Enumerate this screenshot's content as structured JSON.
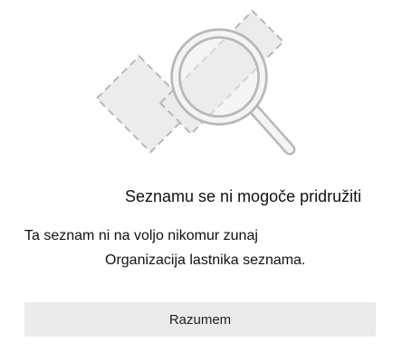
{
  "dialog": {
    "illustration_icon": "magnifier-with-dashed-shapes-icon",
    "title": "Seznamu se ni mogoče pridružiti",
    "message_line1": "Ta seznam ni na voljo nikomur zunaj",
    "message_line2": "Organizacija lastnika seznama.",
    "button_label": "Razumem"
  },
  "colors": {
    "button_bg": "#ebebeb",
    "illustration_fill": "#ececec",
    "illustration_stroke": "#b8b8b8"
  }
}
